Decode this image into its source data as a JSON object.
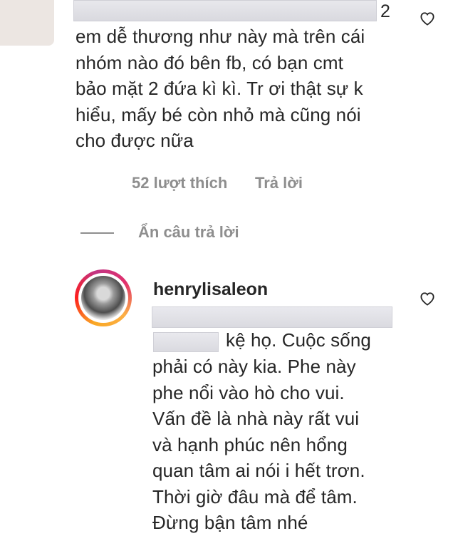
{
  "comment": {
    "redacted_suffix": "2",
    "lines": [
      "em dễ thương như này mà trên cái",
      "nhóm nào đó bên fb, có bạn cmt",
      "bảo mặt 2 đứa kì kì. Tr ơi thật sự k",
      "hiểu, mấy bé còn nhỏ mà cũng nói",
      "cho được nữa"
    ],
    "likes_label": "52 lượt thích",
    "reply_label": "Trả lời",
    "like_icon": "heart-outline-icon"
  },
  "thread": {
    "hide_replies_label": "Ẩn câu trả lời"
  },
  "reply": {
    "username": "henrylisaleon",
    "first_line": "kệ họ. Cuộc sống",
    "lines": [
      "phải có này kia. Phe này",
      "phe nổi vào hò cho vui.",
      "Vấn đề là nhà này rất vui",
      "và hạnh phúc nên hổng",
      "quan tâm ai nói i hết trơn.",
      "Thời giờ đâu mà để tâm.",
      "Đừng bận tâm nhé"
    ],
    "like_icon": "heart-outline-icon"
  }
}
